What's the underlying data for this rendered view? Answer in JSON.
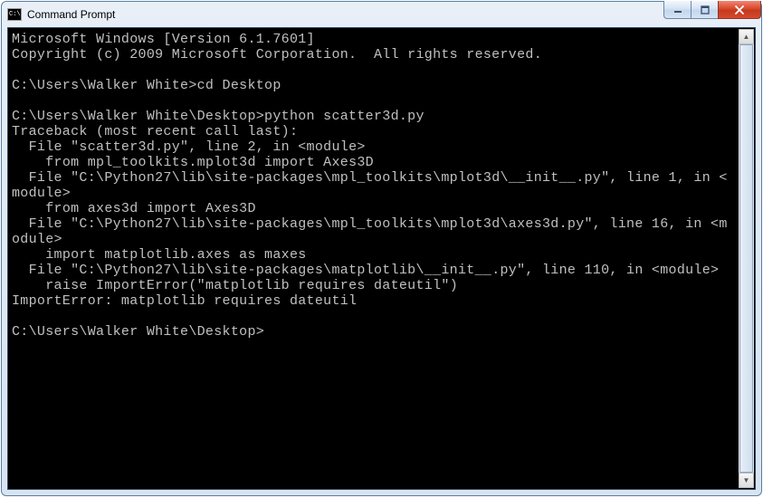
{
  "window": {
    "title": "Command Prompt",
    "icon_label": "cmd-icon"
  },
  "terminal": {
    "lines": [
      "Microsoft Windows [Version 6.1.7601]",
      "Copyright (c) 2009 Microsoft Corporation.  All rights reserved.",
      "",
      "C:\\Users\\Walker White>cd Desktop",
      "",
      "C:\\Users\\Walker White\\Desktop>python scatter3d.py",
      "Traceback (most recent call last):",
      "  File \"scatter3d.py\", line 2, in <module>",
      "    from mpl_toolkits.mplot3d import Axes3D",
      "  File \"C:\\Python27\\lib\\site-packages\\mpl_toolkits\\mplot3d\\__init__.py\", line 1, in <module>",
      "    from axes3d import Axes3D",
      "  File \"C:\\Python27\\lib\\site-packages\\mpl_toolkits\\mplot3d\\axes3d.py\", line 16, in <module>",
      "    import matplotlib.axes as maxes",
      "  File \"C:\\Python27\\lib\\site-packages\\matplotlib\\__init__.py\", line 110, in <module>",
      "    raise ImportError(\"matplotlib requires dateutil\")",
      "ImportError: matplotlib requires dateutil",
      "",
      "C:\\Users\\Walker White\\Desktop>"
    ]
  }
}
